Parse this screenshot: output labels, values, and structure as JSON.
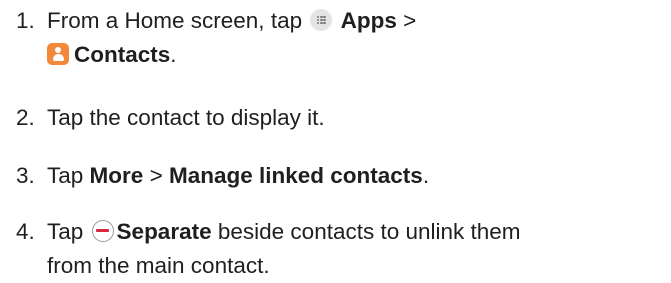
{
  "steps": [
    {
      "number": "1.",
      "text_1": "From a Home screen, tap",
      "apps_label": "Apps",
      "separator": ">",
      "contacts_label": "Contacts",
      "period": ".",
      "icons": [
        "apps-grid-icon",
        "contacts-person-icon"
      ]
    },
    {
      "number": "2.",
      "text": "Tap the contact to display it."
    },
    {
      "number": "3.",
      "text_1": "Tap",
      "more_label": "More",
      "separator": ">",
      "manage_label": "Manage linked contacts",
      "period": "."
    },
    {
      "number": "4.",
      "text_1": "Tap",
      "separate_label": "Separate",
      "text_2": "beside contacts to unlink them",
      "text_3": "from the main contact.",
      "icons": [
        "remove-minus-icon"
      ]
    }
  ],
  "colors": {
    "text": "#1f1f1f",
    "contacts_icon": "#f2883a",
    "remove_minus": "#d7263d",
    "apps_icon_bg": "#e4e4e4"
  }
}
